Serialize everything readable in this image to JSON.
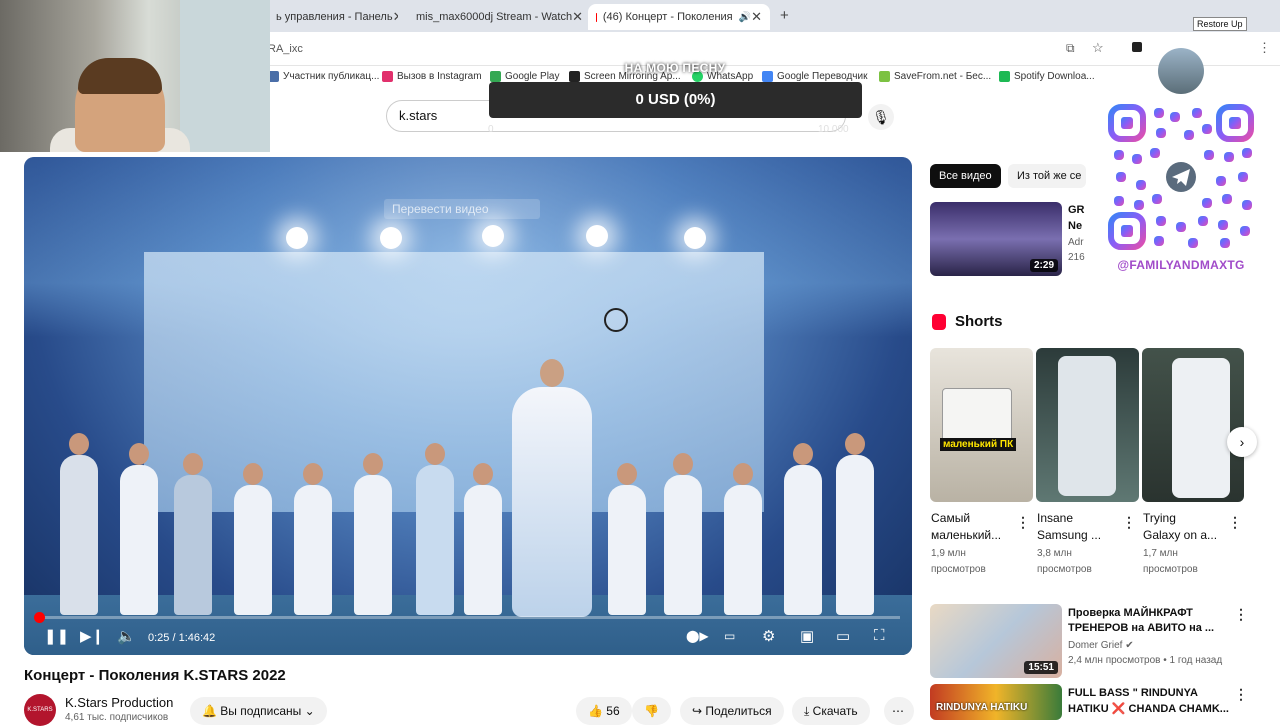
{
  "browser": {
    "tabs": [
      {
        "label": "ь управления - Панель",
        "icon_color": "#4b6cb7"
      },
      {
        "label": "mis_max6000dj Stream - Watch",
        "icon_color": "#53fc18"
      },
      {
        "label": "(46) Концерт - Поколения",
        "icon_color": "#ff0000"
      }
    ],
    "url_fragment": "RA_ixc",
    "restore_tooltip": "Restore Up",
    "bookmarks": [
      {
        "label": "Участник публикац...",
        "color": "#ffffff"
      },
      {
        "label": "Вызов в Instagram",
        "color": "#e1306c"
      },
      {
        "label": "Google Play",
        "color": "#34a853"
      },
      {
        "label": "Screen Mirroring Ap...",
        "color": "#222222"
      },
      {
        "label": "WhatsApp",
        "color": "#25d366"
      },
      {
        "label": "Google Переводчик",
        "color": "#4285f4"
      },
      {
        "label": "SaveFrom.net - Бес...",
        "color": "#7cc242"
      },
      {
        "label": "Spotify Downloa...",
        "color": "#1db954"
      }
    ]
  },
  "search": {
    "value": "k.stars"
  },
  "donation": {
    "title": "НА МОЮ ПЕСНУ",
    "amount": "0 USD (0%)",
    "min": "0",
    "max": "10 000"
  },
  "player": {
    "translate_label": "Перевести видео",
    "time": "0:25 / 1:46:42",
    "progress_fraction": 0.004
  },
  "video": {
    "title": "Концерт - Поколения K.STARS 2022",
    "channel": "K.Stars Production",
    "channel_avatar_text": "K.STARS",
    "subscribers": "4,61 тыс. подписчиков",
    "subscribed_label": "Вы подписаны",
    "likes": "56",
    "share_label": "Поделиться",
    "download_label": "Скачать"
  },
  "sidebar": {
    "chips": [
      "Все видео",
      "Из той же се"
    ],
    "first_video": {
      "title_line1": "GR",
      "title_line2": "Ne",
      "channel": "Adr",
      "views": "216",
      "duration": "2:29"
    },
    "shorts_heading": "Shorts",
    "shorts": [
      {
        "title_line1": "Самый",
        "title_line2": "маленький...",
        "views_line1": "1,9 млн",
        "views_line2": "просмотров",
        "overlay": "маленький ПК"
      },
      {
        "title_line1": "Insane",
        "title_line2": "Samsung ...",
        "views_line1": "3,8 млн",
        "views_line2": "просмотров",
        "overlay": ""
      },
      {
        "title_line1": "Trying",
        "title_line2": "Galaxy on a...",
        "views_line1": "1,7 млн",
        "views_line2": "просмотров",
        "overlay": ""
      }
    ],
    "videos": [
      {
        "title_line1": "Проверка МАЙНКРАФТ",
        "title_line2": "ТРЕНЕРОВ на АВИТО на ...",
        "channel": "Domer Grief",
        "meta": "2,4 млн просмотров • 1 год назад",
        "duration": "15:51"
      },
      {
        "title_line1": "FULL BASS \" RINDUNYA",
        "title_line2": "HATIKU ❌ CHANDA CHAMK...",
        "thumb_text": "RINDUNYA HATIKU"
      }
    ]
  },
  "overlay": {
    "qr_handle": "@FAMILYANDMAXTG",
    "accent": "#a14bc9"
  }
}
